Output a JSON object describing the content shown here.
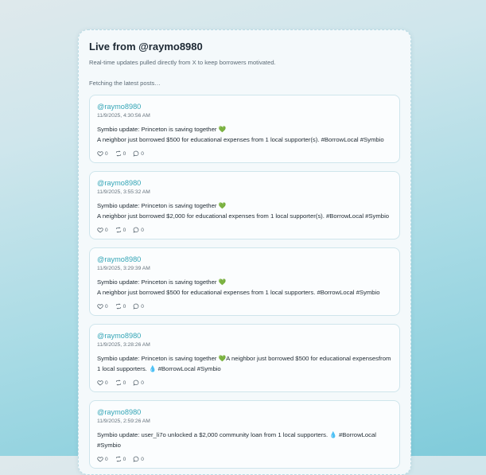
{
  "header": {
    "title": "Live from @raymo8980",
    "subtitle": "Real-time updates pulled directly from X to keep borrowers motivated.",
    "status": "Fetching the latest posts…"
  },
  "tweets": [
    {
      "handle": "@raymo8980",
      "time": "11/9/2025, 4:30:56 AM",
      "text": "Symbio update: Princeton is saving together 💚\nA neighbor just borrowed $500 for educational expenses from 1 local supporter(s). #BorrowLocal #Symbio",
      "likes": "0",
      "retweets": "0",
      "replies": "0"
    },
    {
      "handle": "@raymo8980",
      "time": "11/9/2025, 3:55:32 AM",
      "text": "Symbio update: Princeton is saving together 💚\nA neighbor just borrowed $2,000 for educational expenses from 1 local supporter(s). #BorrowLocal #Symbio",
      "likes": "0",
      "retweets": "0",
      "replies": "0"
    },
    {
      "handle": "@raymo8980",
      "time": "11/9/2025, 3:29:39 AM",
      "text": "Symbio update: Princeton is saving together 💚\nA neighbor just borrowed $500 for educational expenses from 1 local supporters. #BorrowLocal #Symbio",
      "likes": "0",
      "retweets": "0",
      "replies": "0"
    },
    {
      "handle": "@raymo8980",
      "time": "11/9/2025, 3:28:26 AM",
      "text": "Symbio update: Princeton is saving together 💚A neighbor just borrowed $500 for educational expensesfrom 1 local supporters. 💧 #BorrowLocal #Symbio",
      "likes": "0",
      "retweets": "0",
      "replies": "0"
    },
    {
      "handle": "@raymo8980",
      "time": "11/9/2025, 2:59:26 AM",
      "text": "Symbio update: user_li7o unlocked a $2,000 community loan from 1 local supporters. 💧 #BorrowLocal #Symbio",
      "likes": "0",
      "retweets": "0",
      "replies": "0"
    }
  ]
}
